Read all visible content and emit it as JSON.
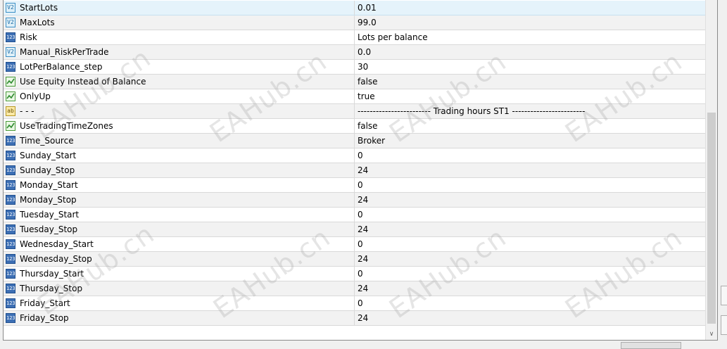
{
  "parameters": [
    {
      "icon": "dbl",
      "name": "StartLots",
      "value": "0.01"
    },
    {
      "icon": "dbl",
      "name": "MaxLots",
      "value": "99.0"
    },
    {
      "icon": "num",
      "name": "Risk",
      "value": "Lots per balance"
    },
    {
      "icon": "dbl",
      "name": "Manual_RiskPerTrade",
      "value": "0.0"
    },
    {
      "icon": "num",
      "name": "LotPerBalance_step",
      "value": "30"
    },
    {
      "icon": "bool",
      "name": "Use Equity Instead of Balance",
      "value": "false"
    },
    {
      "icon": "bool",
      "name": "OnlyUp",
      "value": "true"
    },
    {
      "icon": "str",
      "name": "- - -",
      "value": "------------------------ Trading hours ST1 ------------------------"
    },
    {
      "icon": "bool",
      "name": "UseTradingTimeZones",
      "value": "false"
    },
    {
      "icon": "num",
      "name": "Time_Source",
      "value": "Broker"
    },
    {
      "icon": "num",
      "name": "Sunday_Start",
      "value": "0"
    },
    {
      "icon": "num",
      "name": "Sunday_Stop",
      "value": "24"
    },
    {
      "icon": "num",
      "name": "Monday_Start",
      "value": "0"
    },
    {
      "icon": "num",
      "name": "Monday_Stop",
      "value": "24"
    },
    {
      "icon": "num",
      "name": "Tuesday_Start",
      "value": "0"
    },
    {
      "icon": "num",
      "name": "Tuesday_Stop",
      "value": "24"
    },
    {
      "icon": "num",
      "name": "Wednesday_Start",
      "value": "0"
    },
    {
      "icon": "num",
      "name": "Wednesday_Stop",
      "value": "24"
    },
    {
      "icon": "num",
      "name": "Thursday_Start",
      "value": "0"
    },
    {
      "icon": "num",
      "name": "Thursday_Stop",
      "value": "24"
    },
    {
      "icon": "num",
      "name": "Friday_Start",
      "value": "0"
    },
    {
      "icon": "num",
      "name": "Friday_Stop",
      "value": "24"
    }
  ],
  "icon_labels": {
    "num": "123",
    "dbl": "V2",
    "str": "ab",
    "bool": "bool-chart-icon"
  },
  "watermark_text": "EAHub.cn",
  "scroll_down_glyph": "∨",
  "colors": {
    "selected_row": "#e5f3fb",
    "alt_row": "#f2f2f2",
    "grid_line": "#d9d9d9"
  }
}
